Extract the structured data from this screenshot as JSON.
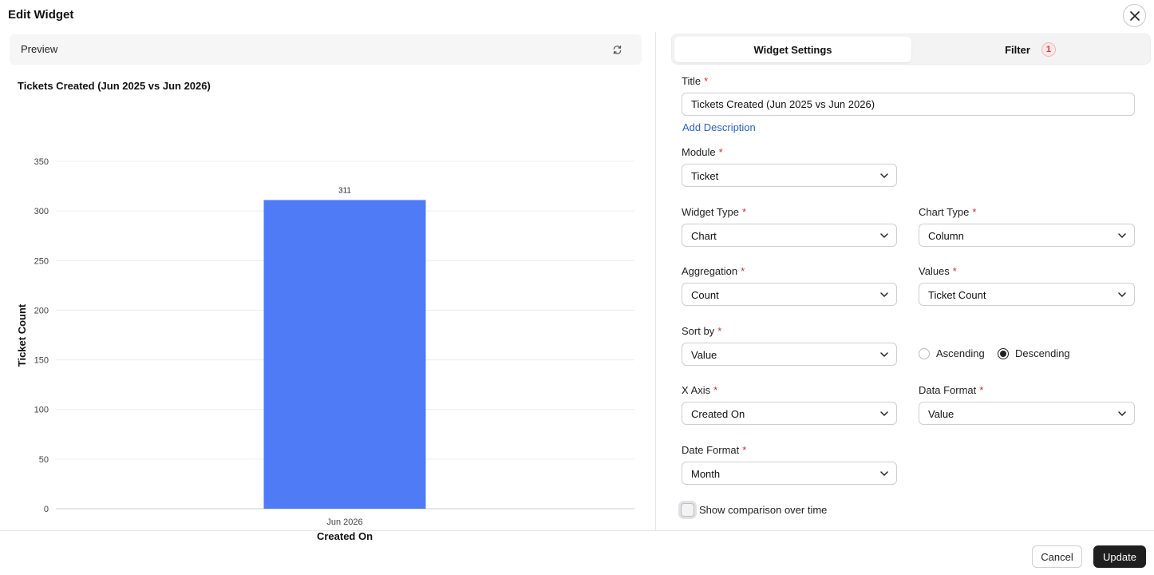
{
  "header": {
    "title": "Edit Widget"
  },
  "preview": {
    "label": "Preview",
    "chart_title": "Tickets Created (Jun 2025 vs Jun 2026)"
  },
  "chart_data": {
    "type": "bar",
    "title": "Tickets Created (Jun 2025 vs Jun 2026)",
    "categories": [
      "Jun 2026"
    ],
    "values": [
      311
    ],
    "data_labels": [
      "311"
    ],
    "xlabel": "Created On",
    "ylabel": "Ticket Count",
    "ylim": [
      0,
      350
    ],
    "yticks": [
      0,
      50,
      100,
      150,
      200,
      250,
      300,
      350
    ],
    "grid": true,
    "bar_color": "#4f7bf6"
  },
  "tabs": {
    "settings_label": "Widget Settings",
    "filter_label": "Filter",
    "filter_count": "1"
  },
  "form": {
    "title_label": "Title",
    "title_value": "Tickets Created (Jun 2025 vs Jun 2026)",
    "add_description": "Add Description",
    "module_label": "Module",
    "module_value": "Ticket",
    "widget_type_label": "Widget Type",
    "widget_type_value": "Chart",
    "chart_type_label": "Chart Type",
    "chart_type_value": "Column",
    "aggregation_label": "Aggregation",
    "aggregation_value": "Count",
    "values_label": "Values",
    "values_value": "Ticket Count",
    "sort_by_label": "Sort by",
    "sort_by_value": "Value",
    "ascending_label": "Ascending",
    "descending_label": "Descending",
    "x_axis_label": "X Axis",
    "x_axis_value": "Created On",
    "data_format_label": "Data Format",
    "data_format_value": "Value",
    "date_format_label": "Date Format",
    "date_format_value": "Month",
    "comparison_label": "Show comparison over time",
    "required_mark": "*"
  },
  "footer": {
    "cancel_label": "Cancel",
    "update_label": "Update"
  },
  "colors": {
    "accent": "#1f1f1f",
    "link": "#2a62c9",
    "required": "#d62d2d",
    "bar": "#4f7bf6"
  }
}
